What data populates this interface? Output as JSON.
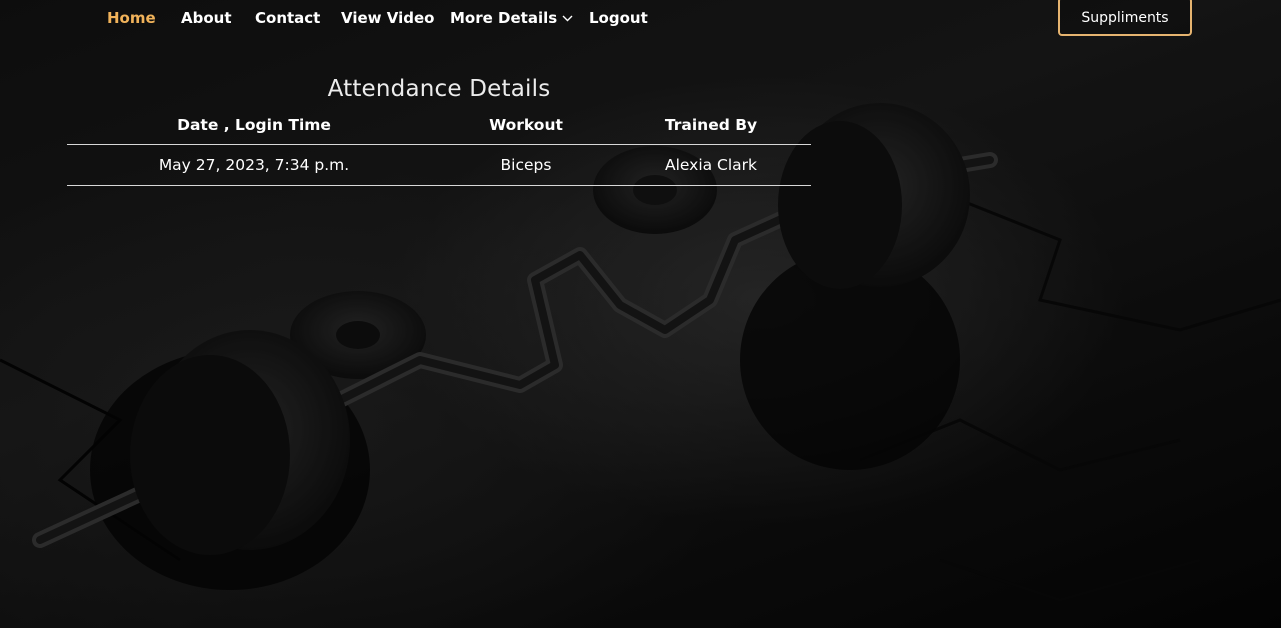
{
  "nav": {
    "items": [
      {
        "label": "Home",
        "active": true
      },
      {
        "label": "About"
      },
      {
        "label": "Contact"
      },
      {
        "label": "View Video"
      },
      {
        "label": "More Details",
        "has_dropdown": true
      },
      {
        "label": "Logout"
      }
    ],
    "cta_label": "Suppliments"
  },
  "colors": {
    "accent": "#f0b25a",
    "button_border": "#e6b470",
    "text": "#ffffff",
    "background": "#070707"
  },
  "attendance": {
    "title": "Attendance Details",
    "columns": [
      "Date , Login Time",
      "Workout",
      "Trained By"
    ],
    "rows": [
      [
        "May 27, 2023, 7:34 p.m.",
        "Biceps",
        "Alexia Clark"
      ]
    ]
  },
  "icons": {
    "dropdown": "chevron-down-icon"
  }
}
